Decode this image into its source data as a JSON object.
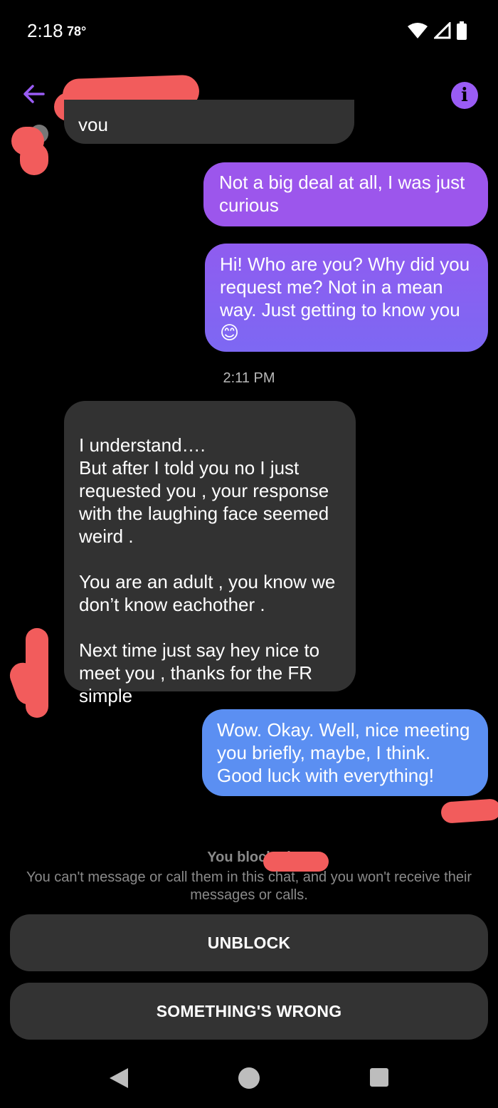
{
  "status_bar": {
    "time": "2:18",
    "temp": "78°"
  },
  "header": {
    "back_icon": "arrow-left-icon",
    "info_icon": "info-icon",
    "accent": "#9a5cf5"
  },
  "messages": [
    {
      "from": "them",
      "text": "you"
    },
    {
      "from": "me",
      "text": "Not a big deal at all, I was just curious"
    },
    {
      "from": "me",
      "text": "Hi! Who are you? Why did you request me? Not in a mean way. Just getting to know you 😊"
    },
    {
      "from": "them",
      "text": "I understand….\nBut after I told you no I just requested you , your response with the laughing face seemed weird .\n\nYou are an adult , you know we don’t know eachother .\n\nNext time just say hey nice to meet you , thanks for the FR simple"
    },
    {
      "from": "me",
      "text": "Wow. Okay. Well, nice meeting you briefly, maybe, I think. Good luck with everything!"
    }
  ],
  "timestamp": "2:11 PM",
  "blocked": {
    "title": "You blocked",
    "text": "You can't message or call them in this chat, and you won't receive their messages or calls."
  },
  "buttons": {
    "unblock": "UNBLOCK",
    "something_wrong": "SOMETHING'S WRONG"
  }
}
